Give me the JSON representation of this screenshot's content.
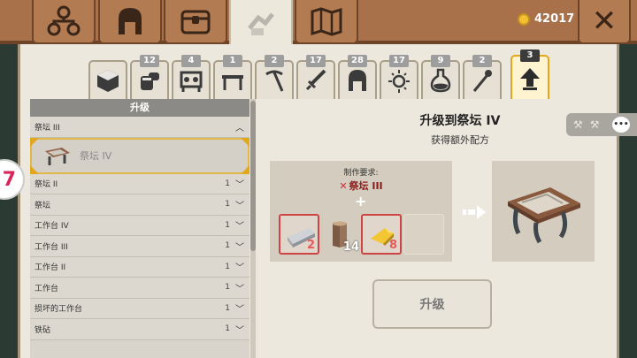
{
  "topbar": {
    "coins": "42017",
    "tabs": [
      "family-tree",
      "helmet",
      "chest",
      "crafting",
      "map"
    ],
    "close_label": "✕"
  },
  "categories": [
    {
      "icon": "cube-icon",
      "badge": ""
    },
    {
      "icon": "stone-icon",
      "badge": "12"
    },
    {
      "icon": "workbench-icon",
      "badge": "4"
    },
    {
      "icon": "table-icon",
      "badge": "1"
    },
    {
      "icon": "pickaxe-icon",
      "badge": "2"
    },
    {
      "icon": "sword-icon",
      "badge": "17"
    },
    {
      "icon": "helmet-icon",
      "badge": "28"
    },
    {
      "icon": "sparkle-icon",
      "badge": "17"
    },
    {
      "icon": "potion-icon",
      "badge": "9"
    },
    {
      "icon": "staff-icon",
      "badge": "2"
    },
    {
      "icon": "upgrade-arrow-icon",
      "badge": "3"
    }
  ],
  "list": {
    "header": "升级",
    "expanded": {
      "label": "祭坛 III",
      "sub": "祭坛 IV"
    },
    "rows": [
      {
        "label": "祭坛 II",
        "count": "1"
      },
      {
        "label": "祭坛",
        "count": "1"
      },
      {
        "label": "工作台 IV",
        "count": "1"
      },
      {
        "label": "工作台 III",
        "count": "1"
      },
      {
        "label": "工作台 II",
        "count": "1"
      },
      {
        "label": "工作台",
        "count": "1"
      },
      {
        "label": "损坏的工作台",
        "count": "1"
      },
      {
        "label": "铁砧",
        "count": "1"
      }
    ]
  },
  "detail": {
    "title": "升级到祭坛 IV",
    "subtitle": "获得额外配方",
    "requirement_label": "制作要求:",
    "requirement_item": "祭坛 III",
    "materials": [
      {
        "name": "silver-bar",
        "qty": "2",
        "state": "missing"
      },
      {
        "name": "wood-log",
        "qty": "14",
        "state": "ok"
      },
      {
        "name": "gold-nugget",
        "qty": "8",
        "state": "missing"
      },
      {
        "name": "empty-slot",
        "qty": "",
        "state": "empty"
      }
    ],
    "button": "升级"
  },
  "colors": {
    "accent": "#e0a81a",
    "missing": "#cc4444",
    "topbar": "#a8714a"
  }
}
